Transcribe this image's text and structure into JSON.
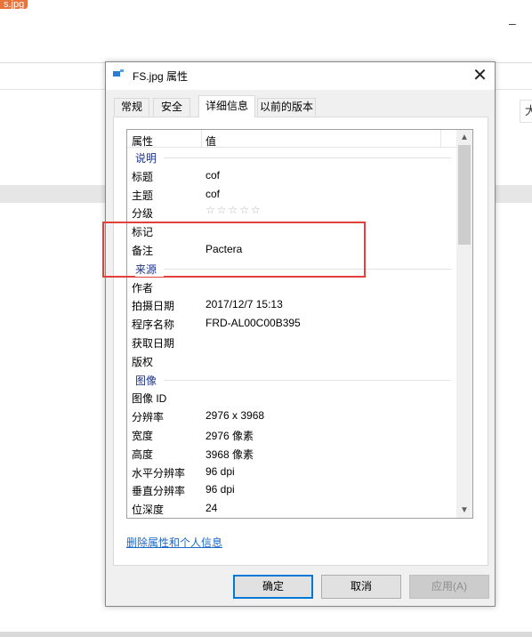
{
  "background": {
    "tab_label": "s.jpg",
    "minimize_glyph": "–",
    "right_field_text": "大"
  },
  "dialog": {
    "title": "FS.jpg 属性",
    "close_glyph": "✕",
    "tabs": [
      {
        "label": "常规",
        "active": false
      },
      {
        "label": "安全",
        "active": false
      },
      {
        "label": "详细信息",
        "active": true
      },
      {
        "label": "以前的版本",
        "active": false
      }
    ],
    "columns": {
      "property": "属性",
      "value": "值"
    },
    "groups": {
      "description": "说明",
      "origin": "来源",
      "image": "图像"
    },
    "rows_description": [
      {
        "key": "标题",
        "value": "cof"
      },
      {
        "key": "主题",
        "value": "cof"
      },
      {
        "key": "分级",
        "value": "☆☆☆☆☆",
        "rating": 0,
        "rating_max": 5
      },
      {
        "key": "标记",
        "value": ""
      },
      {
        "key": "备注",
        "value": "Pactera"
      }
    ],
    "rows_origin": [
      {
        "key": "作者",
        "value": ""
      },
      {
        "key": "拍摄日期",
        "value": "2017/12/7 15:13"
      },
      {
        "key": "程序名称",
        "value": "FRD-AL00C00B395"
      },
      {
        "key": "获取日期",
        "value": ""
      },
      {
        "key": "版权",
        "value": ""
      }
    ],
    "rows_image": [
      {
        "key": "图像 ID",
        "value": ""
      },
      {
        "key": "分辨率",
        "value": "2976 x 3968"
      },
      {
        "key": "宽度",
        "value": "2976 像素"
      },
      {
        "key": "高度",
        "value": "3968 像素"
      },
      {
        "key": "水平分辨率",
        "value": "96 dpi"
      },
      {
        "key": "垂直分辨率",
        "value": "96 dpi"
      },
      {
        "key": "位深度",
        "value": "24"
      }
    ],
    "remove_link": "删除属性和个人信息",
    "buttons": {
      "ok": "确定",
      "cancel": "取消",
      "apply": "应用(A)"
    },
    "colors": {
      "group_header": "#1e3287",
      "link": "#1b68c8",
      "highlight": "#e2403a",
      "primary_border": "#0078d7"
    }
  }
}
